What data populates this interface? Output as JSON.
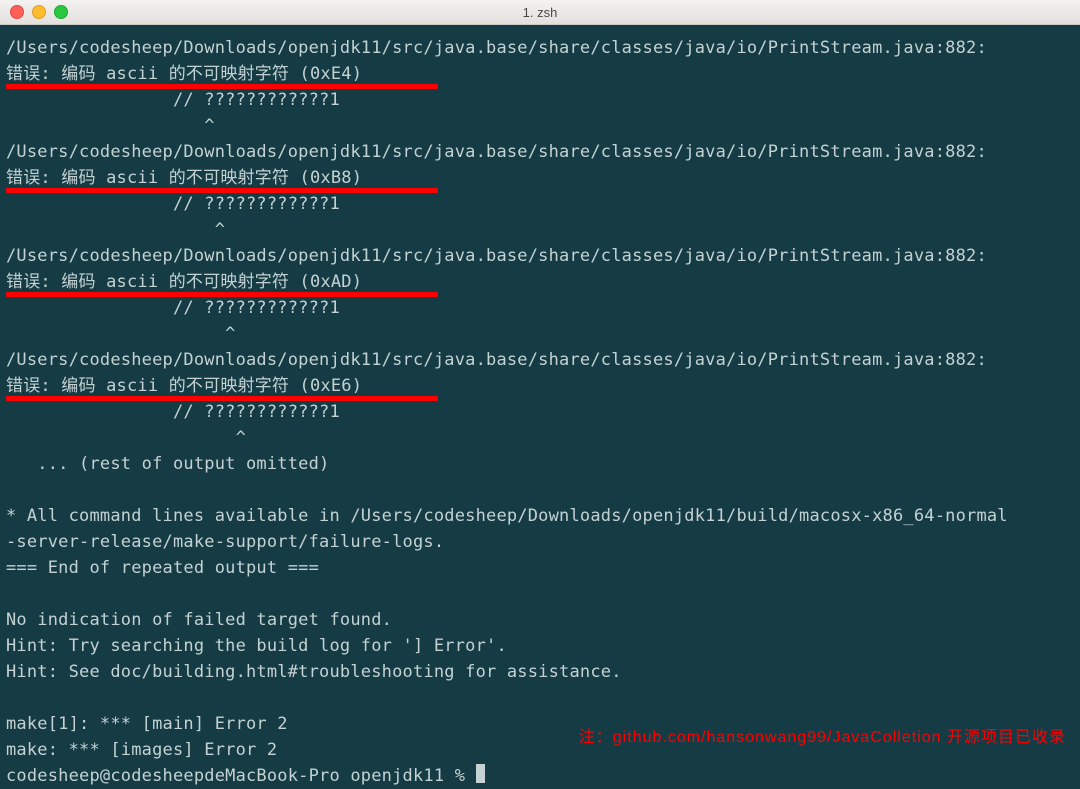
{
  "window": {
    "title": "1. zsh"
  },
  "colors": {
    "background": "#153b44",
    "text": "#c4d2d3",
    "underline": "#ff0000",
    "note": "#ff0000"
  },
  "error_blocks": [
    {
      "path_line": "/Users/codesheep/Downloads/openjdk11/src/java.base/share/classes/java/io/PrintStream.java:882:",
      "msg_line": "错误: 编码 ascii 的不可映射字符 (0xE4)",
      "code_line": "                // ????????????1",
      "caret_line": "                   ^",
      "underline_width": 432
    },
    {
      "path_line": "/Users/codesheep/Downloads/openjdk11/src/java.base/share/classes/java/io/PrintStream.java:882:",
      "msg_line": "错误: 编码 ascii 的不可映射字符 (0xB8)",
      "code_line": "                // ????????????1",
      "caret_line": "                    ^",
      "underline_width": 432
    },
    {
      "path_line": "/Users/codesheep/Downloads/openjdk11/src/java.base/share/classes/java/io/PrintStream.java:882:",
      "msg_line": "错误: 编码 ascii 的不可映射字符 (0xAD)",
      "code_line": "                // ????????????1",
      "caret_line": "                     ^",
      "underline_width": 432
    },
    {
      "path_line": "/Users/codesheep/Downloads/openjdk11/src/java.base/share/classes/java/io/PrintStream.java:882:",
      "msg_line": "错误: 编码 ascii 的不可映射字符 (0xE6)",
      "code_line": "                // ????????????1",
      "caret_line": "                      ^",
      "underline_width": 432
    }
  ],
  "tail_lines": [
    "   ... (rest of output omitted)",
    "",
    "* All command lines available in /Users/codesheep/Downloads/openjdk11/build/macosx-x86_64-normal",
    "-server-release/make-support/failure-logs.",
    "=== End of repeated output ===",
    "",
    "No indication of failed target found.",
    "Hint: Try searching the build log for '] Error'.",
    "Hint: See doc/building.html#troubleshooting for assistance.",
    "",
    "make[1]: *** [main] Error 2",
    "make: *** [images] Error 2"
  ],
  "prompt": "codesheep@codesheepdeMacBook-Pro openjdk11 % ",
  "footer_note": "注：github.com/hansonwang99/JavaColletion 开源项目已收录"
}
